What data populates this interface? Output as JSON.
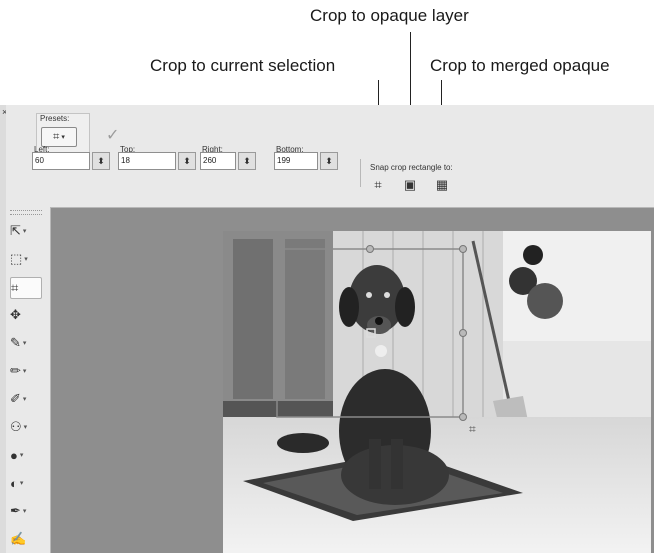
{
  "callouts": {
    "opaque_layer": "Crop to opaque layer",
    "current_selection": "Crop to current selection",
    "merged_opaque": "Crop to merged opaque"
  },
  "options": {
    "presets_label": "Presets:",
    "fields": [
      {
        "label": "Left:",
        "value": "60"
      },
      {
        "label": "Top:",
        "value": "18"
      },
      {
        "label": "Right:",
        "value": "260"
      },
      {
        "label": "Bottom:",
        "value": "199"
      }
    ],
    "snap_label": "Snap crop rectangle to:"
  },
  "colors": {
    "workspace": "#8e8e8e",
    "panel": "#e9e9e9",
    "crop_outline": "#8a8a8a"
  },
  "icons": {
    "apply": "checkmark-icon",
    "snap_current_selection": "crop-current-selection-icon",
    "snap_opaque_layer": "crop-opaque-layer-icon",
    "snap_merged_opaque": "crop-merged-opaque-icon"
  }
}
